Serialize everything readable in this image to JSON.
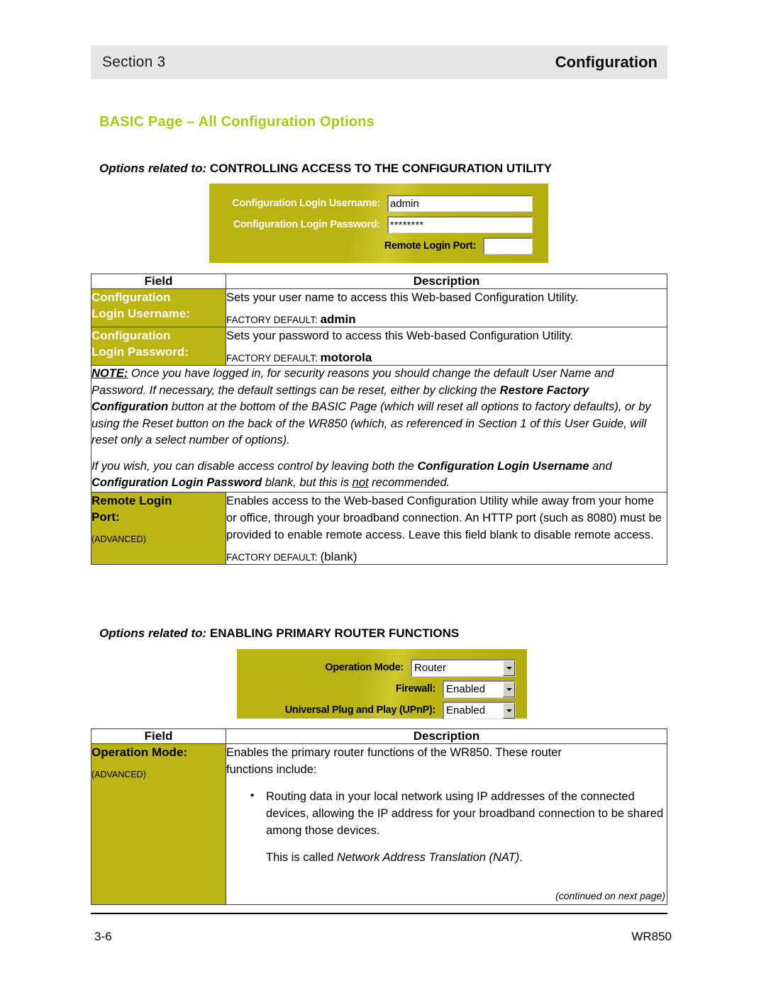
{
  "header": {
    "section_label": "Section 3",
    "chapter_title": "Configuration"
  },
  "heading": {
    "text": "BASIC Page – All Configuration Options",
    "color": "#a5cc12"
  },
  "sections": [
    {
      "options_prefix": "Options related to:",
      "options_title": "CONTROLLING ACCESS TO THE CONFIGURATION UTILITY"
    },
    {
      "options_prefix": "Options related to:",
      "options_title": "ENABLING PRIMARY ROUTER FUNCTIONS"
    }
  ],
  "ui_panel_1": {
    "background_color": "#bdb513",
    "rows": [
      {
        "label": "Configuration Login Username:",
        "label_color": "#ffffff",
        "value": "admin",
        "control": "text-input"
      },
      {
        "label": "Configuration Login Password:",
        "label_color": "#ffffff",
        "value": "********",
        "control": "password-input"
      },
      {
        "label": "Remote Login Port:",
        "label_color": "#000000",
        "value": "",
        "control": "text-input"
      }
    ]
  },
  "ui_panel_2": {
    "background_color": "#bdb513",
    "rows": [
      {
        "label": "Operation Mode:",
        "label_color": "#000000",
        "value": "Router",
        "control": "select"
      },
      {
        "label": "Firewall:",
        "label_color": "#000000",
        "value": "Enabled",
        "control": "select"
      },
      {
        "label": "Universal Plug and Play (UPnP):",
        "label_color": "#000000",
        "value": "Enabled",
        "control": "select"
      }
    ]
  },
  "table_1": {
    "columns": [
      "Field",
      "Description"
    ],
    "rows": [
      {
        "field": "Configuration\nLogin Username:",
        "field_line1": "Configuration",
        "field_line2": "Login Username:",
        "field_text_color": "#ffffff",
        "advanced": "",
        "description": "Sets your user name to access this Web-based Configuration Utility.",
        "factory_label": "FACTORY DEFAULT:",
        "factory_value": "admin"
      },
      {
        "field_line1": "Configuration",
        "field_line2": "Login Password:",
        "field_text_color": "#ffffff",
        "advanced": "",
        "description": "Sets your password to access this Web-based Configuration Utility.",
        "factory_label": "FACTORY DEFAULT:",
        "factory_value": "motorola"
      }
    ],
    "note": {
      "label": "NOTE:",
      "paragraph_1_a": " Once you have logged in, for security reasons you should change the default User Name and Password.  If necessary, the default settings can be reset, either by clicking the ",
      "paragraph_1_b": "Restore Factory Configuration",
      "paragraph_1_c": " button at the bottom of the BASIC Page (which will reset all options to factory defaults), or by using the Reset button on the back of the WR850 (which, as referenced in Section 1 of this User Guide, will reset only a select number of options).",
      "paragraph_2_a": "If you wish, you can disable access control by leaving both the ",
      "paragraph_2_b": "Configuration Login Username",
      "paragraph_2_c": " and ",
      "paragraph_2_d": "Configuration Login Password",
      "paragraph_2_e": " blank, but this is ",
      "paragraph_2_f": "not",
      "paragraph_2_g": " recommended."
    },
    "remote_row": {
      "field_line1": "Remote Login",
      "field_line2": "Port:",
      "field_text_color": "#000000",
      "advanced": "(ADVANCED)",
      "description": "Enables access to the Web-based Configuration Utility while away from your home or office, through your broadband connection. An HTTP port (such as 8080) must be provided to enable remote access.  Leave this field blank to disable remote access.",
      "factory_label": "FACTORY DEFAULT:",
      "factory_value": "(blank)"
    }
  },
  "table_2": {
    "columns": [
      "Field",
      "Description"
    ],
    "row": {
      "field_line1": "Operation Mode:",
      "field_text_color": "#000000",
      "advanced": "(ADVANCED)",
      "description_line1": "Enables the primary router functions of the WR850.  These router",
      "description_line2": "functions include:",
      "bullets": [
        "Routing data in your local network using IP addresses of the connected devices, allowing the IP address for your broadband connection to be shared among those devices."
      ],
      "nat_prefix": "This is called ",
      "nat_italic": "Network Address Translation (NAT)",
      "nat_suffix": ".",
      "continued": "(continued on next page)"
    }
  },
  "footer": {
    "page_number": "3-6",
    "model": "WR850"
  }
}
